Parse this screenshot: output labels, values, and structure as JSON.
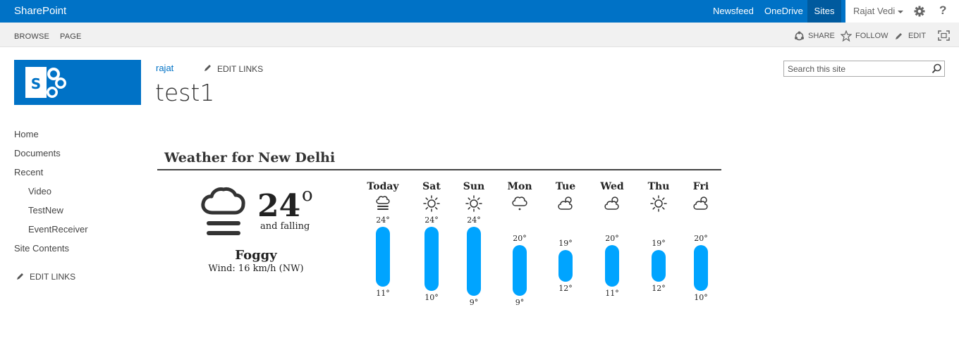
{
  "suite": {
    "brand": "SharePoint",
    "nav": [
      "Newsfeed",
      "OneDrive",
      "Sites"
    ],
    "active_nav": "Sites",
    "user": "Rajat Vedi"
  },
  "ribbon": {
    "tabs": [
      "BROWSE",
      "PAGE"
    ],
    "actions": {
      "share": "SHARE",
      "follow": "FOLLOW",
      "edit": "EDIT"
    }
  },
  "header": {
    "breadcrumb": "rajat",
    "edit_links": "EDIT LINKS",
    "site_title": "test1",
    "search_placeholder": "Search this site"
  },
  "quicklaunch": {
    "items": [
      {
        "label": "Home",
        "indent": false
      },
      {
        "label": "Documents",
        "indent": false
      },
      {
        "label": "Recent",
        "indent": false
      },
      {
        "label": "Video",
        "indent": true
      },
      {
        "label": "TestNew",
        "indent": true
      },
      {
        "label": "EventReceiver",
        "indent": true
      },
      {
        "label": "Site Contents",
        "indent": false
      }
    ],
    "edit_links": "EDIT LINKS"
  },
  "weather": {
    "title": "Weather for New Delhi",
    "current": {
      "temp": "24",
      "degree": "o",
      "trend": "and falling",
      "condition": "Foggy",
      "wind": "Wind: 16 km/h (NW)",
      "icon": "fog-icon"
    },
    "forecast": [
      {
        "day": "Today",
        "icon": "fog-icon",
        "hi": 24,
        "lo": 11
      },
      {
        "day": "Sat",
        "icon": "sun-icon",
        "hi": 24,
        "lo": 10
      },
      {
        "day": "Sun",
        "icon": "sun-icon",
        "hi": 24,
        "lo": 9
      },
      {
        "day": "Mon",
        "icon": "cloud-drizzle-icon",
        "hi": 20,
        "lo": 9
      },
      {
        "day": "Tue",
        "icon": "partly-cloudy-icon",
        "hi": 19,
        "lo": 12
      },
      {
        "day": "Wed",
        "icon": "partly-cloudy-icon",
        "hi": 20,
        "lo": 11
      },
      {
        "day": "Thu",
        "icon": "sun-icon",
        "hi": 19,
        "lo": 12
      },
      {
        "day": "Fri",
        "icon": "partly-cloudy-icon",
        "hi": 20,
        "lo": 10
      }
    ]
  },
  "colors": {
    "suite_blue": "#0072c6",
    "bar_blue": "#00a4ff"
  }
}
